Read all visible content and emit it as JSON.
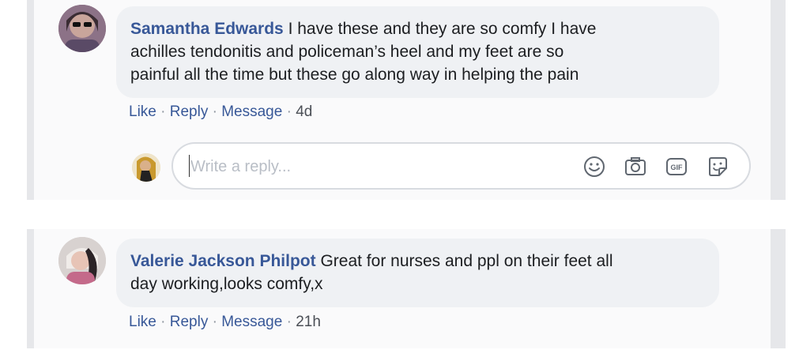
{
  "comments": [
    {
      "author": "Samantha Edwards",
      "text_line1": " I have these and they are so comfy I have",
      "text_line2": "achilles tendonitis and policeman’s heel and my feet are so",
      "text_line3": "painful all the time but these go along way in helping the pain",
      "actions": {
        "like": "Like",
        "reply": "Reply",
        "message": "Message",
        "time": "4d"
      }
    },
    {
      "author": "Valerie Jackson Philpot",
      "text_line1": " Great for nurses and ppl on their feet all",
      "text_line2": "day working,looks comfy,x",
      "actions": {
        "like": "Like",
        "reply": "Reply",
        "message": "Message",
        "time": "21h"
      }
    }
  ],
  "separator": " · ",
  "reply_box": {
    "placeholder": "Write a reply...",
    "icons": [
      "emoji-icon",
      "camera-icon",
      "gif-icon",
      "sticker-icon"
    ],
    "gif_label": "GIF"
  },
  "colors": {
    "author": "#385898",
    "bubble": "#eff1f4",
    "panel_border": "#e6e7ea"
  }
}
